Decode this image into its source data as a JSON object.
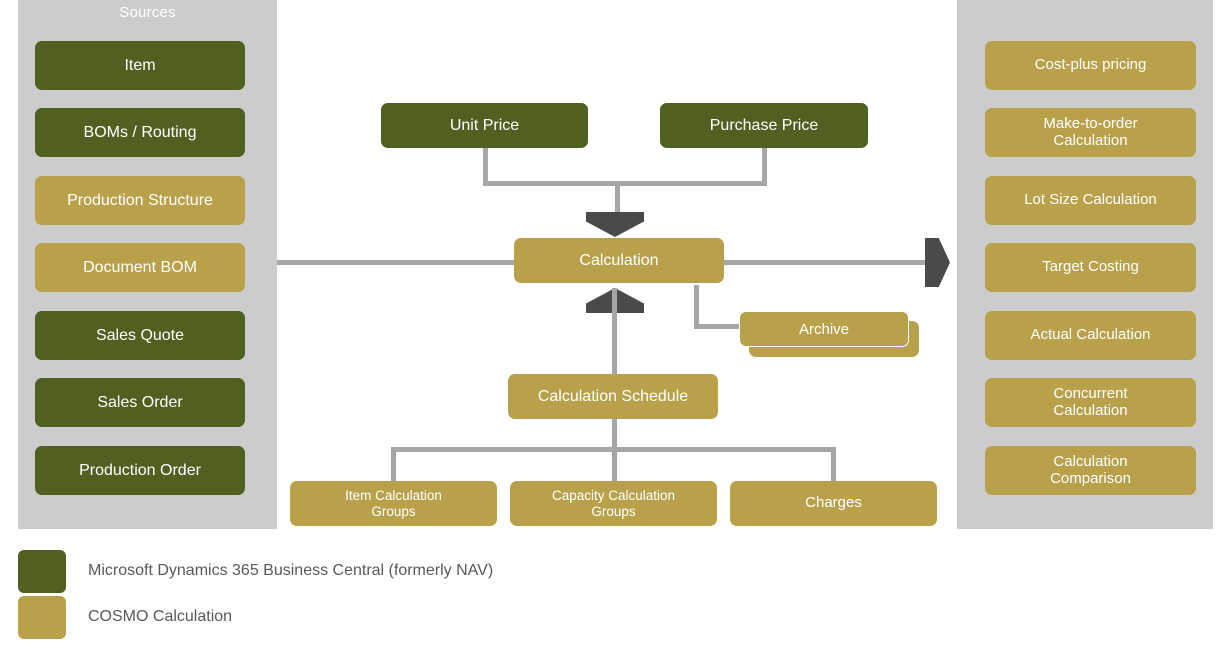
{
  "diagram": {
    "title_sources": "Sources",
    "sources": [
      {
        "label": "Item",
        "color": "green"
      },
      {
        "label": "BOMs / Routing",
        "color": "green"
      },
      {
        "label": "Production Structure",
        "color": "gold"
      },
      {
        "label": "Document BOM",
        "color": "gold"
      },
      {
        "label": "Sales Quote",
        "color": "green"
      },
      {
        "label": "Sales Order",
        "color": "green"
      },
      {
        "label": "Production Order",
        "color": "green"
      }
    ],
    "results": [
      {
        "label": "Cost-plus pricing",
        "color": "gold"
      },
      {
        "label": "Make-to-order\nCalculation",
        "color": "gold"
      },
      {
        "label": "Lot Size Calculation",
        "color": "gold"
      },
      {
        "label": "Target Costing",
        "color": "gold"
      },
      {
        "label": "Actual Calculation",
        "color": "gold"
      },
      {
        "label": "Concurrent\nCalculation",
        "color": "gold"
      },
      {
        "label": "Calculation\nComparison",
        "color": "gold"
      }
    ],
    "center": {
      "unit_price": "Unit Price",
      "purchase_price": "Purchase Price",
      "calculation": "Calculation",
      "archive": "Archive",
      "calculation_schedule": "Calculation Schedule",
      "item_calculation_groups": "Item Calculation\nGroups",
      "capacity_calculation_groups": "Capacity Calculation\nGroups",
      "charges": "Charges"
    }
  },
  "legend": {
    "items": [
      {
        "label": "Microsoft Dynamics 365 Business Central (formerly NAV)",
        "color": "#4F6020"
      },
      {
        "label": "COSMO Calculation",
        "color": "#B8A14A"
      }
    ]
  },
  "colors": {
    "green": "#4F6020",
    "gold": "#B8A14A",
    "panel_gray": "#CCCCCC",
    "connector_gray": "#A6A6A6",
    "arrow_dark": "#4A4A4A",
    "legend_text": "#595959"
  }
}
